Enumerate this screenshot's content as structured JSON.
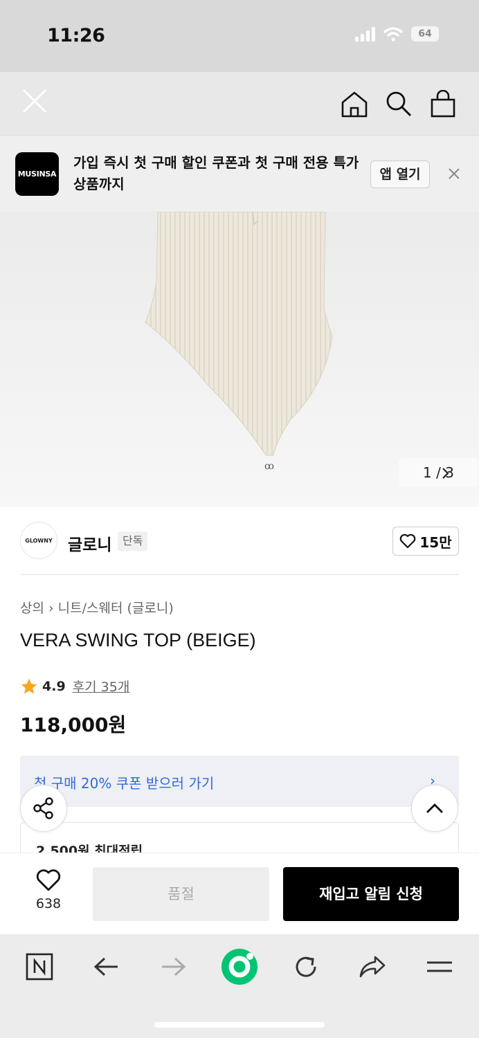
{
  "status_bar": {
    "time": "11:26",
    "battery": "64"
  },
  "banner": {
    "logo_text": "MUSINSA",
    "text": "가입 즉시 첫 구매 할인 쿠폰과 첫 구매 전용 특가 상품까지",
    "open_button": "앱 열기"
  },
  "gallery": {
    "pager": "1 / 3"
  },
  "brand": {
    "logo_text": "GLOWNY",
    "name": "글로니",
    "tag": "단독",
    "likes": "15만"
  },
  "product": {
    "breadcrumb": [
      "상의",
      "니트/스웨터 (글로니)"
    ],
    "title": "VERA SWING TOP (BEIGE)",
    "rating": "4.9",
    "reviews": "후기 35개",
    "price": "118,000원"
  },
  "coupon": {
    "text": "첫 구매 20% 쿠폰 받으러 가기"
  },
  "points": {
    "text": "2,500원 최대적립"
  },
  "purchase_bar": {
    "like_count": "638",
    "soldout_label": "품절",
    "restock_label": "재입고 알림 신청"
  },
  "colors": {
    "accent_blue": "#2f6ad8",
    "star": "#f5a623",
    "brand_green": "#00c473"
  }
}
